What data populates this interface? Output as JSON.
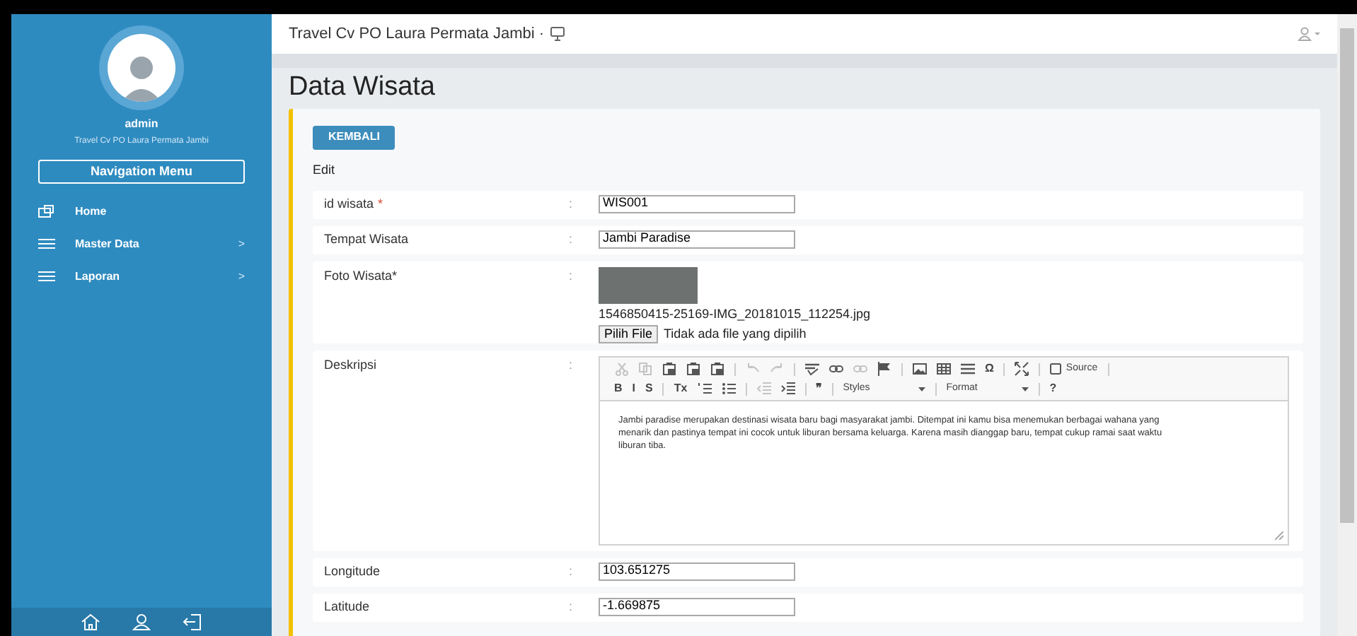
{
  "sidebar": {
    "user": "admin",
    "company": "Travel Cv PO Laura Permata Jambi",
    "nav_title": "Navigation Menu",
    "items": [
      {
        "kind": "home",
        "label": "Home"
      },
      {
        "kind": "list",
        "label": "Master Data",
        "submenu_mark": ">"
      },
      {
        "kind": "list",
        "label": "Laporan",
        "submenu_mark": ">"
      }
    ],
    "footer_icons": [
      {
        "kind": "home"
      },
      {
        "kind": "user"
      },
      {
        "kind": "logout"
      }
    ]
  },
  "header": {
    "title": "Travel Cv PO Laura Permata Jambi ·"
  },
  "page": {
    "title": "Data Wisata",
    "back_button": "KEMBALI",
    "mode": "Edit",
    "fields": [
      {
        "kind": "text",
        "label": "id wisata",
        "required_mark": "*",
        "colon": ":",
        "value": "WIS001"
      },
      {
        "kind": "text",
        "label": "Tempat Wisata",
        "colon": ":",
        "value": "Jambi Paradise"
      },
      {
        "kind": "file",
        "label": "Foto Wisata*",
        "colon": ":",
        "filename": "1546850415-25169-IMG_20181015_112254.jpg",
        "button": "Pilih File",
        "status": "Tidak ada file yang dipilih"
      },
      {
        "kind": "editor",
        "label": "Deskripsi",
        "colon": ":",
        "text": "Jambi paradise merupakan destinasi wisata baru bagi masyarakat jambi. Ditempat ini kamu bisa menemukan berbagai wahana yang menarik dan pastinya tempat ini cocok untuk liburan bersama keluarga. Karena masih dianggap baru, tempat cukup ramai saat waktu liburan tiba.",
        "toolbar": [
          [
            {
              "kind": "scissors",
              "disabled": true
            },
            {
              "kind": "copy",
              "disabled": true
            },
            {
              "kind": "paste",
              "disabled": false
            },
            {
              "kind": "paste",
              "disabled": false
            },
            {
              "kind": "paste",
              "disabled": false
            },
            {
              "kind": "sep"
            },
            {
              "kind": "undo",
              "disabled": true
            },
            {
              "kind": "redo",
              "disabled": true
            },
            {
              "kind": "sep"
            },
            {
              "kind": "spell",
              "disabled": false
            },
            {
              "kind": "link",
              "disabled": false
            },
            {
              "kind": "link",
              "disabled": true
            },
            {
              "kind": "flag",
              "disabled": false
            },
            {
              "kind": "sep"
            },
            {
              "kind": "image",
              "disabled": false
            },
            {
              "kind": "table",
              "disabled": false
            },
            {
              "kind": "rule",
              "disabled": false
            },
            {
              "kind": "glyph",
              "text": "Ω",
              "disabled": false
            },
            {
              "kind": "sep"
            },
            {
              "kind": "maximize",
              "disabled": false
            },
            {
              "kind": "sep"
            },
            {
              "kind": "source",
              "text": "Source",
              "disabled": false
            },
            {
              "kind": "sep"
            }
          ],
          [
            {
              "kind": "glyph",
              "text": "B",
              "disabled": false
            },
            {
              "kind": "glyph",
              "text": "I",
              "disabled": false
            },
            {
              "kind": "glyph",
              "text": "S",
              "disabled": false
            },
            {
              "kind": "sep"
            },
            {
              "kind": "glyph",
              "text": "Tx",
              "disabled": false
            },
            {
              "kind": "numlist",
              "disabled": false
            },
            {
              "kind": "bullist",
              "disabled": false
            },
            {
              "kind": "sep"
            },
            {
              "kind": "outdent",
              "disabled": true
            },
            {
              "kind": "indent",
              "disabled": false
            },
            {
              "kind": "sep"
            },
            {
              "kind": "glyph",
              "text": "❞",
              "disabled": false
            },
            {
              "kind": "sep"
            },
            {
              "kind": "combo",
              "text": "Styles",
              "disabled": false
            },
            {
              "kind": "sep"
            },
            {
              "kind": "combo",
              "text": "Format",
              "disabled": false
            },
            {
              "kind": "sep"
            },
            {
              "kind": "glyph",
              "text": "?",
              "disabled": false
            }
          ]
        ]
      },
      {
        "kind": "text",
        "label": "Longitude",
        "colon": ":",
        "value": "103.651275"
      },
      {
        "kind": "text",
        "label": "Latitude",
        "colon": ":",
        "value": "-1.669875"
      }
    ]
  }
}
